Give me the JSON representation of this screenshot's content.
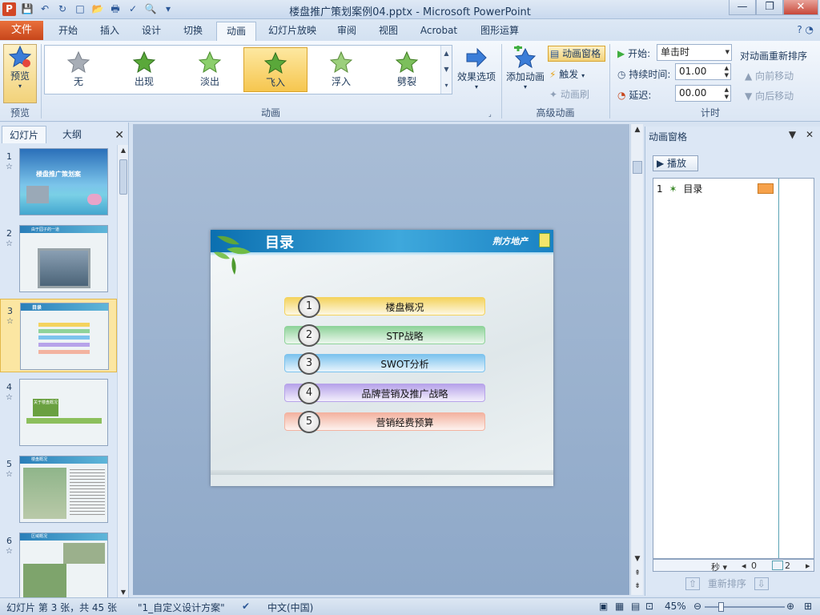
{
  "window": {
    "app_letter": "P",
    "title": "楼盘推广策划案例04.pptx - Microsoft PowerPoint",
    "minimize": "—",
    "restore": "❐",
    "close": "✕"
  },
  "qat": [
    "💾",
    "↶",
    "↻",
    "□",
    "📂",
    "🖶",
    "✓",
    "🔍",
    "▾"
  ],
  "tabs": {
    "file": "文件",
    "items": [
      "开始",
      "插入",
      "设计",
      "切换",
      "动画",
      "幻灯片放映",
      "审阅",
      "视图",
      "Acrobat",
      "图形运算"
    ],
    "active": "动画",
    "help": "? ◔"
  },
  "ribbon": {
    "preview_label": "预览",
    "preview_group": "预览",
    "animation_group": "动画",
    "gallery": [
      "无",
      "出现",
      "淡出",
      "飞入",
      "浮入",
      "劈裂"
    ],
    "selected": "飞入",
    "effect_options": "效果选项",
    "add_animation": "添加动画",
    "animation_pane": "动画窗格",
    "trigger": "触发",
    "painter": "动画刷",
    "advanced_group": "高级动画",
    "start_label": "开始:",
    "start_value": "单击时",
    "duration_label": "持续时间:",
    "duration_value": "01.00",
    "delay_label": "延迟:",
    "delay_value": "00.00",
    "timing_group": "计时",
    "reorder_title": "对动画重新排序",
    "move_earlier": "向前移动",
    "move_later": "向后移动",
    "colors": {
      "accent": "#d24726",
      "selected": "#f6c64f",
      "star": "#5aa83a"
    }
  },
  "left_pane": {
    "tab_slides": "幻灯片",
    "tab_outline": "大纲",
    "close": "✕",
    "thumbs": [
      {
        "num": "1",
        "caption": "楼盘推广策划案"
      },
      {
        "num": "2",
        "caption": "由于园子的一道"
      },
      {
        "num": "3",
        "caption": "目录"
      },
      {
        "num": "4",
        "caption": "关于楼盘概况"
      },
      {
        "num": "5",
        "caption": "楼盘概况"
      },
      {
        "num": "6",
        "caption": "区域概况"
      }
    ],
    "star": "☆"
  },
  "slide": {
    "title": "目录",
    "brand": "荆方地产",
    "items": [
      {
        "num": "1",
        "label": "楼盘概况",
        "color": "#f4d35e"
      },
      {
        "num": "2",
        "label": "STP战略",
        "color": "#8fd39a"
      },
      {
        "num": "3",
        "label": "SWOT分析",
        "color": "#7cc3ee"
      },
      {
        "num": "4",
        "label": "品牌营销及推广战略",
        "color": "#b7a3ea"
      },
      {
        "num": "5",
        "label": "营销经费预算",
        "color": "#f3b3a0"
      }
    ]
  },
  "anim_pane": {
    "title": "动画窗格",
    "dropdown": "▼",
    "close": "✕",
    "play": "▶ 播放",
    "entry_num": "1",
    "entry_icon": "✶",
    "entry_label": "目录",
    "timeline_unit": "秒 ▾",
    "timeline_0": "0",
    "timeline_2": "2",
    "reorder": "重新排序"
  },
  "status": {
    "slide_info": "幻灯片 第 3 张，共 45 张",
    "theme": "\"1_自定义设计方案\"",
    "language": "中文(中国)",
    "zoom": "45%"
  }
}
